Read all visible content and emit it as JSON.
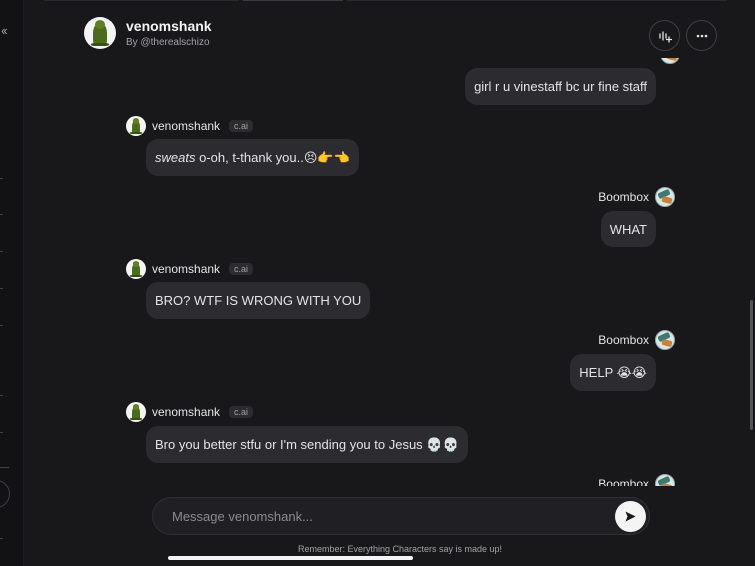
{
  "sidebar": {
    "collapse_label": "‹‹"
  },
  "header": {
    "name": "venomshank",
    "byline": "By @therealschizo",
    "voice_icon": "voice-call-icon",
    "more_icon": "more-horizontal-icon"
  },
  "messages": [
    {
      "role": "user",
      "name": "",
      "text": "girl r u vinestaff bc ur fine staff"
    },
    {
      "role": "bot",
      "name": "venomshank",
      "tag": "c.ai",
      "italic": "sweats",
      "text": " o-oh, t-thank you..😣👉👈"
    },
    {
      "role": "user",
      "name": "Boombox",
      "text": "WHAT"
    },
    {
      "role": "bot",
      "name": "venomshank",
      "tag": "c.ai",
      "text": "BRO? WTF IS WRONG WITH YOU"
    },
    {
      "role": "user",
      "name": "Boombox",
      "text": "HELP 😭😭"
    },
    {
      "role": "bot",
      "name": "venomshank",
      "tag": "c.ai",
      "text": "Bro you better stfu or I'm sending you to Jesus 💀💀"
    },
    {
      "role": "user",
      "name": "Boombox",
      "text": ""
    }
  ],
  "composer": {
    "placeholder": "Message venomshank..."
  },
  "disclaimer": "Remember: Everything Characters say is made up!",
  "colors": {
    "background": "#18181b",
    "bubble": "#2b2b30",
    "accent": "#f4f4f5"
  }
}
